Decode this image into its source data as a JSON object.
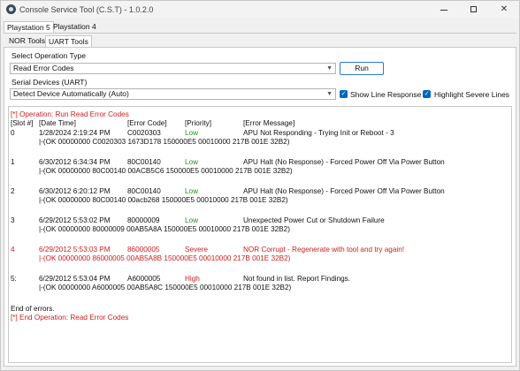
{
  "window": {
    "title": "Console Service Tool (C.S.T) - 1.0.2.0",
    "controls": {
      "minimize": "—",
      "maximize": "□",
      "close": "✕"
    }
  },
  "console_tabs": [
    "Playstation 5",
    "Playstation 4"
  ],
  "tool_tabs": [
    "NOR Tools",
    "UART Tools"
  ],
  "operation": {
    "label": "Select Operation Type",
    "value": "Read Error Codes",
    "run_label": "Run"
  },
  "serial": {
    "label": "Serial Devices (UART)",
    "value": "Detect Device Automatically (Auto)",
    "show_line_response": "Show Line Response",
    "highlight_severe": "Highlight Severe Lines"
  },
  "log": {
    "header_line": "[*] Operation: Run Read Error Codes",
    "columns": [
      "[Slot #]",
      "[Date Time]",
      "[Error Code]",
      "[Priority]",
      "[Error Message]"
    ],
    "entries": [
      {
        "slot": "0",
        "datetime": "1/28/2024 2:19:24 PM",
        "code": "C0020303",
        "priority": "Low",
        "message": "APU Not Responding - Trying Init or Reboot - 3",
        "detail": "|-(OK 00000000 C0020303 1673D178 150000E5 00010000 217B 001E 32B2)",
        "severe": false
      },
      {
        "slot": "1",
        "datetime": "6/30/2012 6:34:34 PM",
        "code": "80C00140",
        "priority": "Low",
        "message": "APU Halt (No Response) - Forced Power Off Via Power Button",
        "detail": "|-(OK 00000000 80C00140 00ACB5C6 150000E5 00010000 217B 001E 32B2)",
        "severe": false
      },
      {
        "slot": "2",
        "datetime": "6/30/2012 6:20:12 PM",
        "code": "80C00140",
        "priority": "Low",
        "message": "APU Halt (No Response) - Forced Power Off Via Power Button",
        "detail": "|-(OK 00000000 80C00140 00acb268 150000E5 00010000 217B 001E 32B2)",
        "severe": false
      },
      {
        "slot": "3",
        "datetime": "6/29/2012 5:53:02 PM",
        "code": "80000009",
        "priority": "Low",
        "message": "Unexpected Power Cut or Shutdown Failure",
        "detail": "|-(OK 00000000 80000009 00AB5A8A 150000E5 00010000 217B 001E 32B2)",
        "severe": false
      },
      {
        "slot": "4",
        "datetime": "6/29/2012 5:53:03 PM",
        "code": "86000005",
        "priority": "Severe",
        "message": "NOR Corrupt - Regenerate with tool and try again!",
        "detail": "|-(OK 00000000 86000005 00AB5A8B 150000E5 00010000 217B 001E 32B2)",
        "severe": true
      },
      {
        "slot": "5:",
        "datetime": "6/29/2012 5:53:04 PM",
        "code": "A6000005",
        "priority": "High",
        "message": "Not found in list. Report Findings.",
        "detail": "|-(OK 00000000 A6000005 00AB5A8C 150000E5 00010000 217B 001E 32B2)",
        "severe": false
      }
    ],
    "end_of_errors": "End of errors.",
    "footer_line": "[*] End Operation: Read Error Codes"
  },
  "colors": {
    "severe": "#cc1f1f",
    "low": "#2a8a2a",
    "high": "#cc1f1f",
    "accent": "#0067c0"
  }
}
